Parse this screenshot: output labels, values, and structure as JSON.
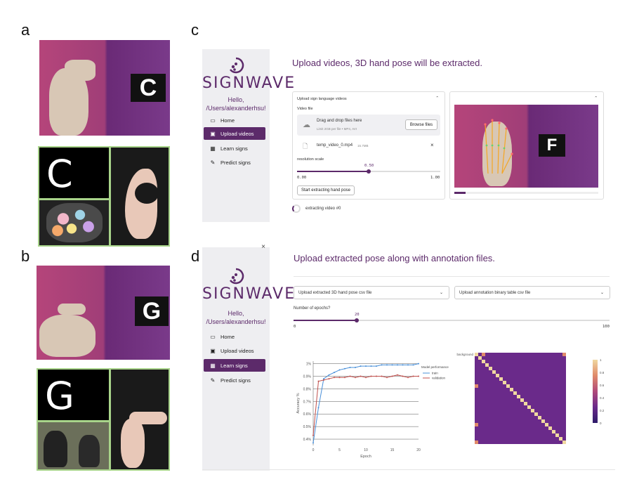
{
  "panels": {
    "a": "a",
    "b": "b",
    "c": "c",
    "d": "d"
  },
  "photos": {
    "a_letter": "C",
    "a_card_letters": "C c",
    "b_letter": "G",
    "b_card_letters": "G g",
    "c_letter": "F"
  },
  "app": {
    "logo": "SIGNWAVE",
    "hello_line1": "Hello,",
    "hello_line2": "/Users/alexanderhsu!",
    "nav": [
      "Home",
      "Upload videos",
      "Learn signs",
      "Predict signs"
    ],
    "close_icon": "×"
  },
  "upload": {
    "heading": "Upload videos, 3D hand pose will be extracted.",
    "section_title": "Upload sign language videos",
    "video_file_label": "Video file",
    "drop_title": "Drag and drop files here",
    "drop_limit": "Limit 2GB per file • MP4, AVI",
    "browse_label": "Browse files",
    "file_name": "temp_video_0.mp4",
    "file_size": "15.7MB",
    "resolution_label": "resolution scale",
    "resolution_value": "0.50",
    "resolution_min": "0.00",
    "resolution_max": "1.00",
    "extract_button": "Start extracting hand pose",
    "status": "extracting video #0"
  },
  "learn": {
    "heading": "Upload extracted pose along with annotation files.",
    "dropdown_pose": "Upload extracted 3D hand pose csv file",
    "dropdown_annot": "Upload annotation binary table csv file",
    "epochs_label": "Number of epochs?",
    "epochs_value": "20",
    "epochs_min": "0",
    "epochs_max": "100"
  },
  "chart_data": [
    {
      "type": "line",
      "title": "",
      "xlabel": "Epoch",
      "ylabel": "Accuracy %",
      "legend_title": "Model performance",
      "x": [
        0,
        1,
        2,
        3,
        4,
        5,
        6,
        7,
        8,
        9,
        10,
        11,
        12,
        13,
        14,
        15,
        16,
        17,
        18,
        19,
        20
      ],
      "series": [
        {
          "name": "train",
          "color": "#4a90d9",
          "values": [
            0.37,
            0.65,
            0.88,
            0.91,
            0.93,
            0.95,
            0.96,
            0.97,
            0.97,
            0.98,
            0.98,
            0.98,
            0.98,
            0.99,
            0.99,
            0.99,
            0.99,
            0.99,
            0.99,
            0.99,
            1.0
          ]
        },
        {
          "name": "validation",
          "color": "#c0504d",
          "values": [
            0.43,
            0.86,
            0.87,
            0.88,
            0.89,
            0.89,
            0.89,
            0.9,
            0.89,
            0.9,
            0.89,
            0.9,
            0.9,
            0.9,
            0.89,
            0.9,
            0.91,
            0.9,
            0.89,
            0.9,
            0.9
          ]
        }
      ],
      "xticks": [
        "0",
        "5",
        "10",
        "15",
        "20"
      ],
      "yticks": [
        "0.4%",
        "0.5%",
        "0.6%",
        "0.7%",
        "0.8%",
        "0.9%",
        "1%"
      ],
      "ylim": [
        0.35,
        1.02
      ]
    },
    {
      "type": "heatmap",
      "first_row_label": "background",
      "n": 26,
      "colorbar_ticks": [
        "1",
        "0.8",
        "0.6",
        "0.4",
        "0.2",
        "0"
      ],
      "colorscale": [
        "#2d1b69",
        "#6a2a8a",
        "#b04a7a",
        "#e08a6a",
        "#f0d8a0"
      ]
    }
  ]
}
